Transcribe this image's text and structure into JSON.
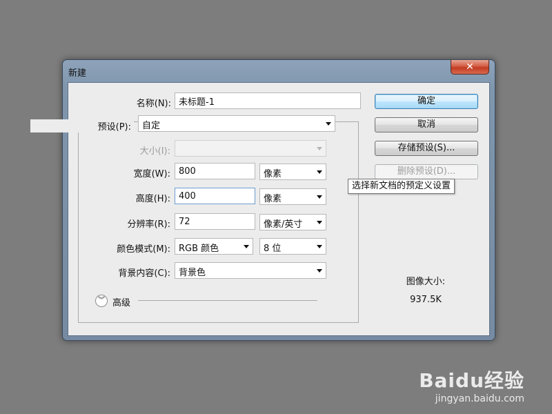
{
  "dialog": {
    "title": "新建",
    "close_symbol": "✕"
  },
  "form": {
    "name": {
      "label": "名称(N):",
      "value": "未标题-1"
    },
    "preset": {
      "label": "预设(P):",
      "value": "自定"
    },
    "size": {
      "label": "大小(I):",
      "value": ""
    },
    "width": {
      "label": "宽度(W):",
      "value": "800",
      "unit": "像素"
    },
    "height": {
      "label": "高度(H):",
      "value": "400",
      "unit": "像素"
    },
    "resolution": {
      "label": "分辨率(R):",
      "value": "72",
      "unit": "像素/英寸"
    },
    "color_mode": {
      "label": "颜色模式(M):",
      "value": "RGB 颜色",
      "depth": "8 位"
    },
    "background": {
      "label": "背景内容(C):",
      "value": "背景色"
    },
    "advanced": {
      "label": "高级",
      "icon": "double-chevron-down-icon"
    }
  },
  "buttons": {
    "ok": "确定",
    "cancel": "取消",
    "save_preset": "存储预设(S)...",
    "delete_preset": "删除预设(D)..."
  },
  "tooltip": "选择新文档的预定义设置",
  "image_size": {
    "label": "图像大小:",
    "value": "937.5K"
  },
  "watermark": {
    "logo": "Baidu经验",
    "url": "jingyan.baidu.com"
  }
}
